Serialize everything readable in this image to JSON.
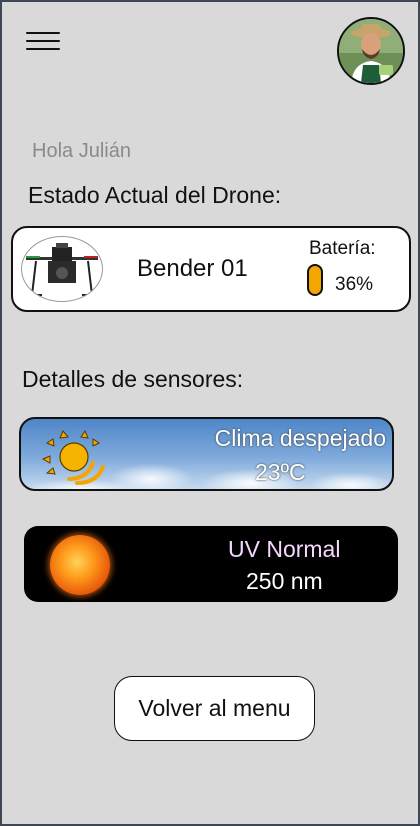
{
  "header": {
    "menu_icon": "hamburger-menu-icon",
    "avatar_icon": "user-avatar-photo"
  },
  "greeting": "Hola Julián",
  "drone_section": {
    "title": "Estado Actual del Drone:",
    "drone": {
      "name": "Bender 01",
      "battery_label": "Batería:",
      "battery_percent": "36%",
      "battery_color": "#f5a500"
    }
  },
  "sensors_section": {
    "title": "Detalles de sensores:",
    "weather": {
      "status": "Clima despejado",
      "temperature": "23ºC",
      "icon": "sun-icon"
    },
    "uv": {
      "status": "UV Normal",
      "value": "250 nm",
      "icon": "sun-icon"
    }
  },
  "back_button": {
    "label": "Volver al menu"
  }
}
